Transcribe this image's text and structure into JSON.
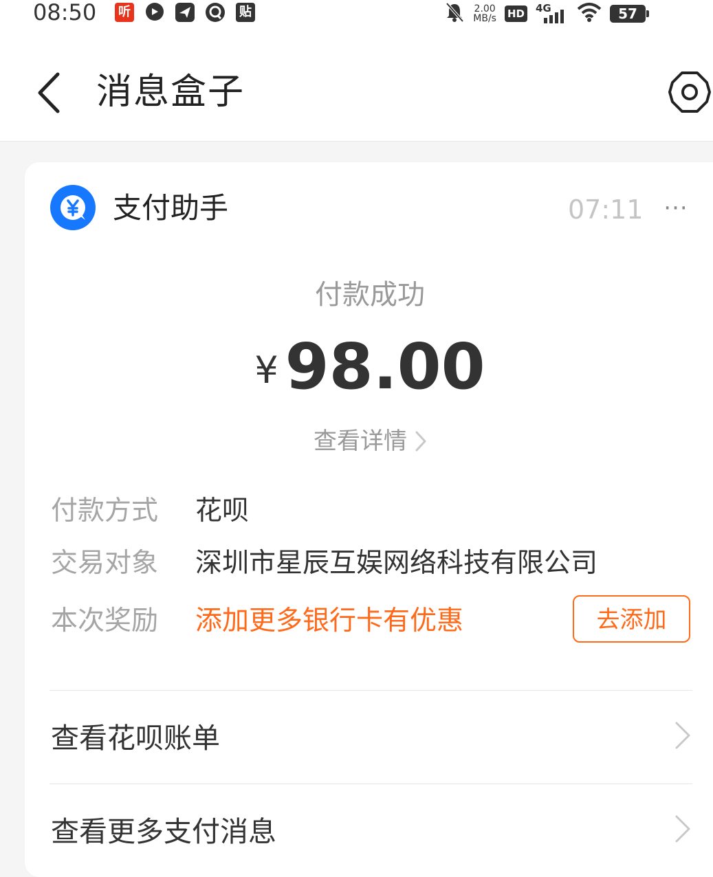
{
  "status_bar": {
    "time": "08:50",
    "app_icons": [
      "ting-icon",
      "message-bubble-icon",
      "send-icon",
      "qq-icon",
      "tie-icon"
    ],
    "app_icon_ting_label": "听",
    "app_icon_tie_label": "贴",
    "net_speed_value": "2.00",
    "net_speed_unit": "MB/s",
    "hd_label": "HD",
    "network_label": "4G",
    "battery_level": "57"
  },
  "header": {
    "title": "消息盒子"
  },
  "message": {
    "sender": "支付助手",
    "time": "07:11",
    "more_label": "···",
    "status": "付款成功",
    "currency_symbol": "¥",
    "amount": "98.00",
    "detail_link": "查看详情",
    "fields": [
      {
        "label": "付款方式",
        "value": "花呗"
      },
      {
        "label": "交易对象",
        "value": "深圳市星辰互娱网络科技有限公司"
      },
      {
        "label": "本次奖励",
        "value": "添加更多银行卡有优惠"
      }
    ],
    "add_button": "去添加",
    "links": [
      {
        "label": "查看花呗账单"
      },
      {
        "label": "查看更多支付消息"
      }
    ]
  },
  "colors": {
    "accent_orange": "#ff6a1a",
    "brand_blue": "#1677ff"
  }
}
